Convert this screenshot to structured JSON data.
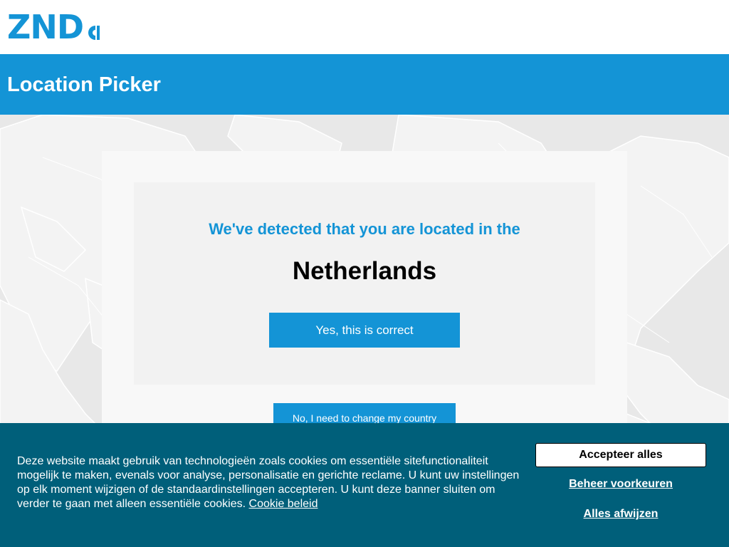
{
  "header": {
    "logo_text": "ZND",
    "title": "Location Picker"
  },
  "location": {
    "detected_text": "We've detected that you are located in the",
    "country": "Netherlands",
    "confirm_label": "Yes, this is correct",
    "change_label": "No, I need to change my country"
  },
  "cookie_banner": {
    "text": "Deze website maakt gebruik van technologieën zoals cookies om essentiële sitefunctionaliteit mogelijk te maken, evenals voor analyse, personalisatie en gerichte reclame. U kunt uw instellingen op elk moment wijzigen of de standaardinstellingen accepteren. U kunt deze banner sluiten om verder te gaan met alleen essentiële cookies.",
    "policy_link": "Cookie beleid",
    "accept_label": "Accepteer alles",
    "manage_label": "Beheer voorkeuren",
    "reject_label": "Alles afwijzen"
  },
  "colors": {
    "brand_blue": "#1494d6",
    "banner_teal": "#005f7a",
    "map_gray": "#e8e8e8"
  }
}
